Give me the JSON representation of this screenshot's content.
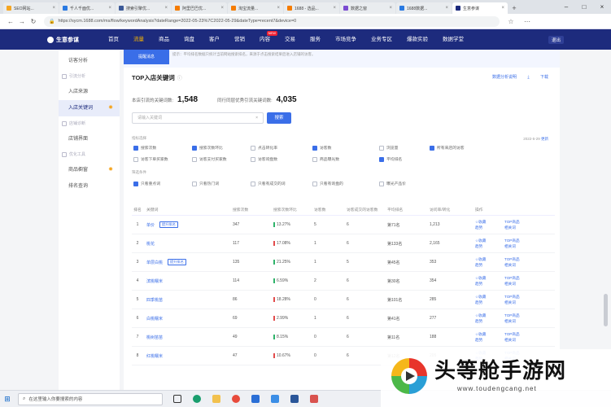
{
  "browser": {
    "tabs": [
      {
        "label": "SEO网站...",
        "color": "#f5a623",
        "active": false
      },
      {
        "label": "千人千面优...",
        "color": "#2a7ae2",
        "active": false
      },
      {
        "label": "搜索引擎优...",
        "color": "#3b5998",
        "active": false
      },
      {
        "label": "阿里巴巴优...",
        "color": "#f57c00",
        "active": false
      },
      {
        "label": "淘宝流量...",
        "color": "#f57c00",
        "active": false
      },
      {
        "label": "1688 - 选品...",
        "color": "#f57c00",
        "active": false
      },
      {
        "label": "数据之窗",
        "color": "#7b4bd1",
        "active": false
      },
      {
        "label": "1688数据...",
        "color": "#2a7ae2",
        "active": false
      },
      {
        "label": "生意参谋",
        "color": "#1d2b7d",
        "active": true
      }
    ],
    "new_tab": "+",
    "url": "https://sycm.1688.com/ms/flow/keywordAnalysis?dateRange=2022-05-23%7C2022-05-29&dateType=recent7&device=0"
  },
  "topnav": {
    "logo": "生意参谋",
    "items": [
      "首页",
      "流量",
      "商品",
      "询盘",
      "客户",
      "营销",
      "内容",
      "交易",
      "服务",
      "市场竞争",
      "业务专区",
      "爆款实验",
      "数据学堂"
    ],
    "active": "流量",
    "new_badge": "NEW",
    "user": "退出"
  },
  "sidebar": {
    "items": [
      {
        "type": "item",
        "label": "访客分析"
      },
      {
        "type": "group",
        "label": "引流分析"
      },
      {
        "type": "item",
        "label": "入店来源"
      },
      {
        "type": "item",
        "label": "入店关键词",
        "active": true,
        "star": true
      },
      {
        "type": "group",
        "label": "店铺诊断"
      },
      {
        "type": "item",
        "label": "店铺界面"
      },
      {
        "type": "group",
        "label": "优化工具"
      },
      {
        "type": "item",
        "label": "商品橱窗",
        "star": true
      },
      {
        "type": "item",
        "label": "排名查询"
      }
    ]
  },
  "main": {
    "notice_btn": "提醒消息",
    "notice_text": "提示：平均排名数据只统计当前网站搜索排名，来源于点击搜索结果后进入店铺的访客。",
    "page_title": "TOP入店关键词",
    "links": [
      "数据分析说明",
      "下载"
    ],
    "stats": [
      {
        "label": "本店引流的关键词数:",
        "value": "1,548"
      },
      {
        "label": "同行同层优秀引流关键词数:",
        "value": "4,035"
      }
    ],
    "search_placeholder": "请输入关键词",
    "search_btn": "搜索",
    "filter_label_1": "指标选择",
    "filter_label_2": "筛选条件",
    "date_hint": "2022-5-29",
    "date_link": "更新",
    "checkboxes_row1": [
      {
        "label": "搜索次数",
        "on": true
      },
      {
        "label": "搜索次数环比",
        "on": true
      },
      {
        "label": "点击转化率",
        "on": false
      },
      {
        "label": "访客数",
        "on": true
      },
      {
        "label": "浏览量",
        "on": false
      },
      {
        "label": "所有来店的访客",
        "on": true
      }
    ],
    "checkboxes_row2": [
      {
        "label": "访客下单买家数",
        "on": false
      },
      {
        "label": "访客支付买家数",
        "on": false
      },
      {
        "label": "访客询盘数",
        "on": false
      },
      {
        "label": "商品曝光数",
        "on": false
      },
      {
        "label": "平均排名",
        "on": true
      }
    ],
    "checkboxes_row3": [
      {
        "label": "只看重点词",
        "on": true
      },
      {
        "label": "只看热门词",
        "on": false
      },
      {
        "label": "只看有成交的词",
        "on": false
      },
      {
        "label": "只看有询盘的",
        "on": false
      },
      {
        "label": "曝光产品价",
        "on": false
      }
    ],
    "table": {
      "headers": [
        "排名",
        "关键词",
        "搜索次数",
        "搜索次数环比",
        "访客数",
        "访客成交的访客数",
        "平均排名",
        "访问率/转化",
        "操作"
      ],
      "rows": [
        {
          "rank": "1",
          "kw": "单价",
          "tag": "提升排名",
          "v1": "347",
          "pct": "13.27%",
          "up": true,
          "v2": "5",
          "v3": "6",
          "v4": "第71名",
          "v5": "1,213"
        },
        {
          "rank": "2",
          "kw": "桃花",
          "tag": "",
          "v1": "117",
          "pct": "17.08%",
          "up": false,
          "v2": "1",
          "v3": "6",
          "v4": "第133名",
          "v5": "2,165"
        },
        {
          "rank": "3",
          "kw": "单层白桃",
          "tag": "提升排名",
          "v1": "135",
          "pct": "21.25%",
          "up": true,
          "v2": "1",
          "v3": "5",
          "v4": "第45名",
          "v5": "353"
        },
        {
          "rank": "4",
          "kw": "滨桃糯米",
          "tag": "",
          "v1": "114",
          "pct": "6.59%",
          "up": true,
          "v2": "2",
          "v3": "6",
          "v4": "第30名",
          "v5": "354"
        },
        {
          "rank": "5",
          "kw": "四季桃苗",
          "tag": "",
          "v1": "86",
          "pct": "18.28%",
          "up": false,
          "v2": "0",
          "v3": "6",
          "v4": "第101名",
          "v5": "285"
        },
        {
          "rank": "6",
          "kw": "白桃糯米",
          "tag": "",
          "v1": "69",
          "pct": "2.99%",
          "up": false,
          "v2": "1",
          "v3": "6",
          "v4": "第41名",
          "v5": "277"
        },
        {
          "rank": "7",
          "kw": "桃树苗苗",
          "tag": "",
          "v1": "49",
          "pct": "8.15%",
          "up": true,
          "v2": "0",
          "v3": "6",
          "v4": "第11名",
          "v5": "188"
        },
        {
          "rank": "8",
          "kw": "红桃糯米",
          "tag": "",
          "v1": "47",
          "pct": "10.67%",
          "up": false,
          "v2": "0",
          "v3": "6",
          "v4": "第12名",
          "v5": "205"
        }
      ],
      "ops_a": [
        "☆收藏",
        "TOP商品"
      ],
      "ops_b": [
        "趋势",
        "相关词"
      ]
    }
  },
  "taskbar": {
    "search_placeholder": "在这里输入你要搜索的内容"
  },
  "watermark": {
    "title": "头等舱手游网",
    "url": "www.toudengcang.net"
  },
  "colors": {
    "nav": "#1d2b7d",
    "accent": "#3a6ee8",
    "active_nav": "#f7b500",
    "up": "#2fb36a",
    "down": "#e24b4b"
  }
}
